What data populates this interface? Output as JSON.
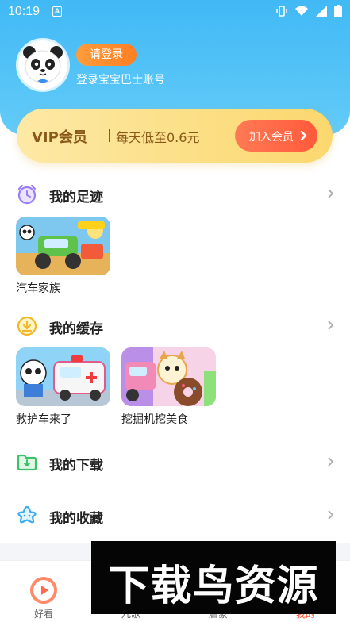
{
  "status_bar": {
    "time": "10:19",
    "notification_glyph": "A"
  },
  "profile": {
    "login_button": "请登录",
    "login_subtitle": "登录宝宝巴士账号"
  },
  "vip": {
    "title": "VIP会员",
    "description": "每天低至0.6元",
    "join_button": "加入会员"
  },
  "sections": {
    "history": {
      "title": "我的足迹",
      "items": [
        {
          "label": "汽车家族"
        }
      ]
    },
    "cache": {
      "title": "我的缓存",
      "items": [
        {
          "label": "救护车来了"
        },
        {
          "label": "挖掘机挖美食"
        }
      ]
    },
    "downloads": {
      "title": "我的下载"
    },
    "favorites": {
      "title": "我的收藏"
    }
  },
  "tabbar": {
    "items": [
      {
        "label": "好看"
      },
      {
        "label": "儿歌"
      },
      {
        "label": "启蒙"
      },
      {
        "label": "我的"
      }
    ]
  },
  "watermark": {
    "text": "下载鸟资源"
  },
  "colors": {
    "header": "#41b9f5",
    "accent_orange": "#ff7f22",
    "vip_gold": "#fbd76e",
    "vip_text": "#8a5a1b",
    "join_red": "#ff5a3c"
  }
}
